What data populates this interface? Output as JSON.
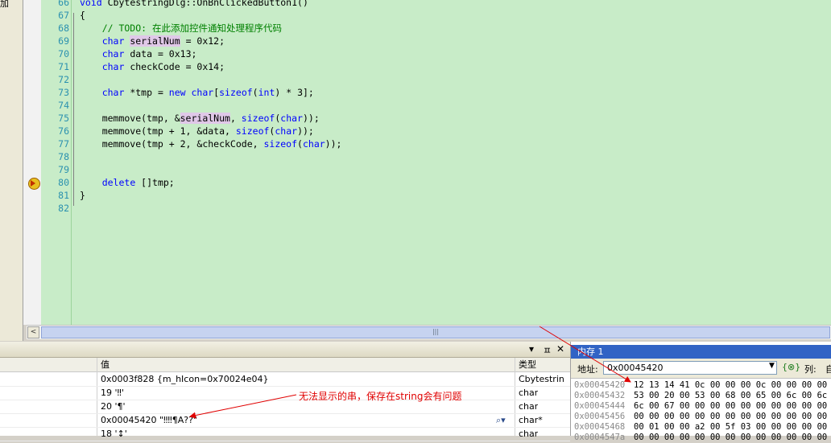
{
  "left_strip": {
    "label": "加"
  },
  "editor": {
    "lines": [
      {
        "num": "66",
        "tokens": [
          {
            "t": "void ",
            "c": "kw"
          },
          {
            "t": "CbytestringDlg::OnBnClickedButton1()",
            "c": ""
          }
        ]
      },
      {
        "num": "67",
        "tokens": [
          {
            "t": "{",
            "c": ""
          }
        ]
      },
      {
        "num": "68",
        "tokens": [
          {
            "t": "    // TODO: 在此添加控件通知处理程序代码",
            "c": "cm"
          }
        ]
      },
      {
        "num": "69",
        "tokens": [
          {
            "t": "    ",
            "c": ""
          },
          {
            "t": "char ",
            "c": "kw"
          },
          {
            "t": "serialNum",
            "c": "hl"
          },
          {
            "t": " = 0x12;",
            "c": ""
          }
        ]
      },
      {
        "num": "70",
        "tokens": [
          {
            "t": "    ",
            "c": ""
          },
          {
            "t": "char ",
            "c": "kw"
          },
          {
            "t": "data = 0x13;",
            "c": ""
          }
        ]
      },
      {
        "num": "71",
        "tokens": [
          {
            "t": "    ",
            "c": ""
          },
          {
            "t": "char ",
            "c": "kw"
          },
          {
            "t": "checkCode = 0x14;",
            "c": ""
          }
        ]
      },
      {
        "num": "72",
        "tokens": []
      },
      {
        "num": "73",
        "tokens": [
          {
            "t": "    ",
            "c": ""
          },
          {
            "t": "char ",
            "c": "kw"
          },
          {
            "t": "*tmp = ",
            "c": ""
          },
          {
            "t": "new char",
            "c": "kw"
          },
          {
            "t": "[",
            "c": ""
          },
          {
            "t": "sizeof",
            "c": "kw"
          },
          {
            "t": "(",
            "c": ""
          },
          {
            "t": "int",
            "c": "kw"
          },
          {
            "t": ") * 3];",
            "c": ""
          }
        ]
      },
      {
        "num": "74",
        "tokens": []
      },
      {
        "num": "75",
        "tokens": [
          {
            "t": "    memmove(tmp, &",
            "c": ""
          },
          {
            "t": "serialNum",
            "c": "hl"
          },
          {
            "t": ", ",
            "c": ""
          },
          {
            "t": "sizeof",
            "c": "kw"
          },
          {
            "t": "(",
            "c": ""
          },
          {
            "t": "char",
            "c": "kw"
          },
          {
            "t": "));",
            "c": ""
          }
        ]
      },
      {
        "num": "76",
        "tokens": [
          {
            "t": "    memmove(tmp + 1, &data, ",
            "c": ""
          },
          {
            "t": "sizeof",
            "c": "kw"
          },
          {
            "t": "(",
            "c": ""
          },
          {
            "t": "char",
            "c": "kw"
          },
          {
            "t": "));",
            "c": ""
          }
        ]
      },
      {
        "num": "77",
        "tokens": [
          {
            "t": "    memmove(tmp + 2, &checkCode, ",
            "c": ""
          },
          {
            "t": "sizeof",
            "c": "kw"
          },
          {
            "t": "(",
            "c": ""
          },
          {
            "t": "char",
            "c": "kw"
          },
          {
            "t": "));",
            "c": ""
          }
        ]
      },
      {
        "num": "78",
        "tokens": []
      },
      {
        "num": "79",
        "tokens": []
      },
      {
        "num": "80",
        "tokens": [
          {
            "t": "    ",
            "c": ""
          },
          {
            "t": "delete ",
            "c": "kw"
          },
          {
            "t": "[]tmp;",
            "c": ""
          }
        ]
      },
      {
        "num": "81",
        "tokens": [
          {
            "t": "}",
            "c": ""
          }
        ]
      },
      {
        "num": "82",
        "tokens": []
      }
    ]
  },
  "scrollbar": {
    "left_arrow": "<",
    "right_arrow": ">",
    "grip": "|||"
  },
  "watch": {
    "buttons": {
      "dropdown": "▾",
      "pin": "ㅍ",
      "close": "✕"
    },
    "headers": {
      "value": "值",
      "type": "类型"
    },
    "rows": [
      {
        "value": "0x0003f828 {m_hIcon=0x70024e04}",
        "type": "Cbytestrin"
      },
      {
        "value": "19 '‼'",
        "type": "char"
      },
      {
        "value": "20 '¶'",
        "type": "char"
      },
      {
        "value": "0x00045420 \"‼‼¶A??\"",
        "type": "char*"
      },
      {
        "value": "18 '↕'",
        "type": "char"
      }
    ],
    "annotation": "无法显示的串，保存在string会有问题"
  },
  "memory": {
    "title": "内存 1",
    "address_label": "地址:",
    "address_value": "0x00045420",
    "refresh_label": "{⊗}",
    "columns_label": "列:",
    "columns_value": "自",
    "rows": [
      {
        "addr": "0x00045420",
        "bytes": "12 13 14 41 0c 00 00 00 0c 00 00 00 00"
      },
      {
        "addr": "0x00045432",
        "bytes": "53 00 20 00 53 00 68 00 65 00 6c 00 6c"
      },
      {
        "addr": "0x00045444",
        "bytes": "6c 00 67 00 00 00 00 00 00 00 00 00 00"
      },
      {
        "addr": "0x00045456",
        "bytes": "00 00 00 00 00 00 00 00 00 00 00 00 00"
      },
      {
        "addr": "0x00045468",
        "bytes": "00 01 00 00 a2 00 5f 03 00 00 00 00 00"
      },
      {
        "addr": "0x0004547a",
        "bytes": "00 00 00 00 00 00 00 00 00 00 00 00 00"
      }
    ]
  },
  "colors": {
    "editor_bg": "#c8ecc8",
    "keyword": "#0000ff",
    "comment": "#008000",
    "line_number": "#2b91af",
    "annotation": "#e00000",
    "memory_title_bg": "#3163c5"
  }
}
